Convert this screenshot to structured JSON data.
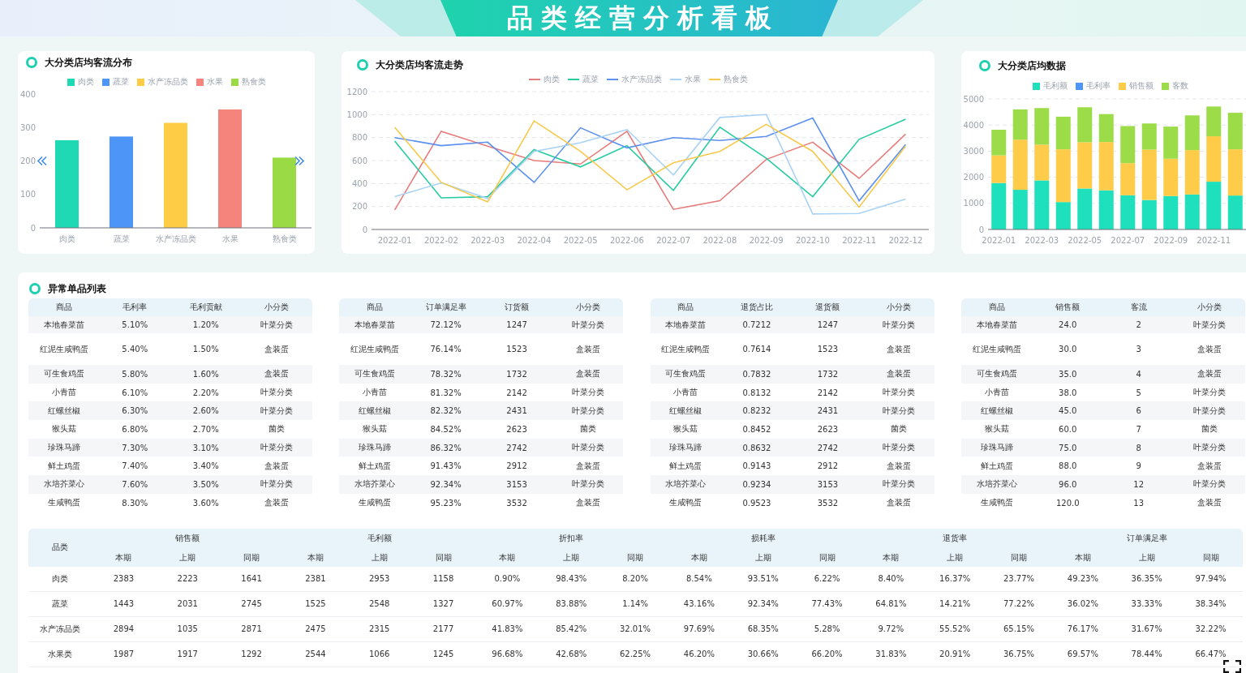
{
  "header": {
    "title": "品类经营分析看板"
  },
  "traffic_distribution": {
    "title": "大分类店均客流分布",
    "chart_data": {
      "type": "bar",
      "categories": [
        "肉类",
        "蔬菜",
        "水产冻品类",
        "水果",
        "熟食类"
      ],
      "ylim": [
        0,
        400
      ],
      "yticks": [
        0,
        100,
        200,
        300,
        400
      ],
      "series": [
        {
          "name": "肉类",
          "color": "#1fd8b4",
          "values": [
            262,
            null,
            null,
            null,
            null
          ]
        },
        {
          "name": "蔬菜",
          "color": "#4d96f7",
          "values": [
            null,
            273,
            null,
            null,
            null
          ]
        },
        {
          "name": "水产冻品类",
          "color": "#ffcd45",
          "values": [
            null,
            null,
            314,
            null,
            null
          ]
        },
        {
          "name": "水果",
          "color": "#f5857c",
          "values": [
            null,
            null,
            null,
            354,
            null
          ]
        },
        {
          "name": "熟食类",
          "color": "#9ada45",
          "values": [
            null,
            null,
            null,
            null,
            210
          ]
        }
      ]
    }
  },
  "traffic_trend": {
    "title": "大分类店均客流走势",
    "chart_data": {
      "type": "line",
      "grid": true,
      "categories": [
        "2022-01",
        "2022-02",
        "2022-03",
        "2022-04",
        "2022-05",
        "2022-06",
        "2022-07",
        "2022-08",
        "2022-09",
        "2022-10",
        "2022-11",
        "2022-12"
      ],
      "ylim": [
        0,
        1200
      ],
      "yticks": [
        0,
        200,
        400,
        600,
        800,
        1000,
        1200
      ],
      "series": [
        {
          "name": "肉类",
          "color": "#e77c7c",
          "values": [
            170,
            855,
            725,
            600,
            570,
            855,
            175,
            250,
            610,
            760,
            445,
            830
          ]
        },
        {
          "name": "蔬菜",
          "color": "#27cca0",
          "values": [
            770,
            275,
            285,
            695,
            545,
            730,
            340,
            890,
            620,
            285,
            785,
            960
          ]
        },
        {
          "name": "水产冻品类",
          "color": "#5b8ff0",
          "values": [
            800,
            730,
            760,
            410,
            885,
            710,
            800,
            775,
            810,
            970,
            250,
            740
          ]
        },
        {
          "name": "水果",
          "color": "#a9d2f5",
          "values": [
            285,
            405,
            270,
            680,
            755,
            870,
            475,
            975,
            1000,
            135,
            140,
            265
          ]
        },
        {
          "name": "熟食类",
          "color": "#f7c94a",
          "values": [
            890,
            410,
            240,
            945,
            680,
            345,
            580,
            680,
            915,
            680,
            195,
            725
          ]
        }
      ]
    }
  },
  "store_data": {
    "title": "大分类店均数据",
    "chart_data": {
      "type": "bar",
      "stacked": true,
      "grid": true,
      "categories": [
        "2022-01",
        null,
        "2022-03",
        null,
        "2022-05",
        null,
        "2022-07",
        null,
        "2022-09",
        null,
        "2022-11",
        null
      ],
      "ylim": [
        0,
        5000
      ],
      "yticks": [
        0,
        1000,
        2000,
        3000,
        4000,
        5000
      ],
      "series": [
        {
          "name": "毛利额",
          "color": "#1ee0bc",
          "values": [
            1780,
            1520,
            1880,
            1050,
            1570,
            1500,
            1310,
            1130,
            1280,
            1340,
            1830,
            1300
          ]
        },
        {
          "name": "毛利率",
          "color": "#4d96f7",
          "values": [
            null,
            null,
            null,
            null,
            null,
            null,
            null,
            null,
            null,
            null,
            null,
            null
          ]
        },
        {
          "name": "销售额",
          "color": "#ffcc4a",
          "values": [
            1060,
            1920,
            1370,
            2020,
            1770,
            1850,
            1230,
            1930,
            1430,
            1700,
            1740,
            1770
          ]
        },
        {
          "name": "客数",
          "color": "#9bdc48",
          "values": [
            980,
            1160,
            1400,
            1250,
            1340,
            1070,
            1420,
            1000,
            1230,
            1330,
            1140,
            1400
          ]
        }
      ]
    }
  },
  "anomaly_list": {
    "title": "异常单品列表",
    "tables": [
      {
        "columns": [
          "商品",
          "毛利率",
          "毛利贡献",
          "小分类"
        ],
        "rows": [
          [
            "本地春菜苗",
            "5.10%",
            "1.20%",
            "叶菜分类"
          ],
          [
            "红泥生咸鸭蛋",
            "5.40%",
            "1.50%",
            "盒装蛋"
          ],
          [
            "可生食鸡蛋",
            "5.80%",
            "1.60%",
            "盒装蛋"
          ],
          [
            "小青苗",
            "6.10%",
            "2.20%",
            "叶菜分类"
          ],
          [
            "红螺丝椒",
            "6.30%",
            "2.60%",
            "叶菜分类"
          ],
          [
            "猴头菇",
            "6.80%",
            "2.70%",
            "菌类"
          ],
          [
            "珍珠马蹄",
            "7.30%",
            "3.10%",
            "叶菜分类"
          ],
          [
            "鲜土鸡蛋",
            "7.40%",
            "3.40%",
            "盒装蛋"
          ],
          [
            "水培芥菜心",
            "7.60%",
            "3.50%",
            "叶菜分类"
          ],
          [
            "生咸鸭蛋",
            "8.30%",
            "3.60%",
            "盒装蛋"
          ]
        ]
      },
      {
        "columns": [
          "商品",
          "订单满足率",
          "订货额",
          "小分类"
        ],
        "rows": [
          [
            "本地春菜苗",
            "72.12%",
            "1247",
            "叶菜分类"
          ],
          [
            "红泥生咸鸭蛋",
            "76.14%",
            "1523",
            "盒装蛋"
          ],
          [
            "可生食鸡蛋",
            "78.32%",
            "1732",
            "盒装蛋"
          ],
          [
            "小青苗",
            "81.32%",
            "2142",
            "叶菜分类"
          ],
          [
            "红螺丝椒",
            "82.32%",
            "2431",
            "叶菜分类"
          ],
          [
            "猴头菇",
            "84.52%",
            "2623",
            "菌类"
          ],
          [
            "珍珠马蹄",
            "86.32%",
            "2742",
            "叶菜分类"
          ],
          [
            "鲜土鸡蛋",
            "91.43%",
            "2912",
            "盒装蛋"
          ],
          [
            "水培芥菜心",
            "92.34%",
            "3153",
            "叶菜分类"
          ],
          [
            "生咸鸭蛋",
            "95.23%",
            "3532",
            "盒装蛋"
          ]
        ]
      },
      {
        "columns": [
          "商品",
          "退货占比",
          "退货额",
          "小分类"
        ],
        "rows": [
          [
            "本地春菜苗",
            "0.7212",
            "1247",
            "叶菜分类"
          ],
          [
            "红泥生咸鸭蛋",
            "0.7614",
            "1523",
            "盒装蛋"
          ],
          [
            "可生食鸡蛋",
            "0.7832",
            "1732",
            "盒装蛋"
          ],
          [
            "小青苗",
            "0.8132",
            "2142",
            "叶菜分类"
          ],
          [
            "红螺丝椒",
            "0.8232",
            "2431",
            "叶菜分类"
          ],
          [
            "猴头菇",
            "0.8452",
            "2623",
            "菌类"
          ],
          [
            "珍珠马蹄",
            "0.8632",
            "2742",
            "叶菜分类"
          ],
          [
            "鲜土鸡蛋",
            "0.9143",
            "2912",
            "盒装蛋"
          ],
          [
            "水培芥菜心",
            "0.9234",
            "3153",
            "叶菜分类"
          ],
          [
            "生咸鸭蛋",
            "0.9523",
            "3532",
            "盒装蛋"
          ]
        ]
      },
      {
        "columns": [
          "商品",
          "销售额",
          "客流",
          "小分类"
        ],
        "rows": [
          [
            "本地春菜苗",
            "24.0",
            "2",
            "叶菜分类"
          ],
          [
            "红泥生咸鸭蛋",
            "30.0",
            "3",
            "盒装蛋"
          ],
          [
            "可生食鸡蛋",
            "35.0",
            "4",
            "盒装蛋"
          ],
          [
            "小青苗",
            "38.0",
            "5",
            "叶菜分类"
          ],
          [
            "红螺丝椒",
            "45.0",
            "6",
            "叶菜分类"
          ],
          [
            "猴头菇",
            "60.0",
            "7",
            "菌类"
          ],
          [
            "珍珠马蹄",
            "75.0",
            "8",
            "叶菜分类"
          ],
          [
            "鲜土鸡蛋",
            "88.0",
            "9",
            "盒装蛋"
          ],
          [
            "水培芥菜心",
            "96.0",
            "12",
            "叶菜分类"
          ],
          [
            "生咸鸭蛋",
            "120.0",
            "13",
            "盒装蛋"
          ]
        ]
      }
    ]
  },
  "category_summary": {
    "corner": "品类",
    "groups": [
      {
        "label": "销售额",
        "subcolumns": [
          "本期",
          "上期",
          "同期"
        ]
      },
      {
        "label": "毛利额",
        "subcolumns": [
          "本期",
          "上期",
          "同期"
        ]
      },
      {
        "label": "折扣率",
        "subcolumns": [
          "本期",
          "上期",
          "同期"
        ]
      },
      {
        "label": "损耗率",
        "subcolumns": [
          "本期",
          "上期",
          "同期"
        ]
      },
      {
        "label": "退货率",
        "subcolumns": [
          "本期",
          "上期",
          "同期"
        ]
      },
      {
        "label": "订单满足率",
        "subcolumns": [
          "本期",
          "上期",
          "同期"
        ]
      }
    ],
    "rows": [
      {
        "category": "肉类",
        "cells": [
          "2383",
          "2223",
          "1641",
          "2381",
          "2953",
          "1158",
          "0.90%",
          "98.43%",
          "8.20%",
          "8.54%",
          "93.51%",
          "6.22%",
          "8.40%",
          "16.37%",
          "23.77%",
          "49.23%",
          "36.35%",
          "97.94%"
        ]
      },
      {
        "category": "蔬菜",
        "cells": [
          "1443",
          "2031",
          "2745",
          "1525",
          "2548",
          "1327",
          "60.97%",
          "83.88%",
          "1.14%",
          "43.16%",
          "92.34%",
          "77.43%",
          "64.81%",
          "14.21%",
          "77.22%",
          "36.02%",
          "33.33%",
          "38.34%"
        ]
      },
      {
        "category": "水产冻品类",
        "cells": [
          "2894",
          "1035",
          "2871",
          "2475",
          "2315",
          "2177",
          "41.83%",
          "85.42%",
          "32.01%",
          "97.69%",
          "68.35%",
          "5.28%",
          "9.72%",
          "55.52%",
          "65.15%",
          "76.17%",
          "31.67%",
          "32.22%"
        ]
      },
      {
        "category": "水果类",
        "cells": [
          "1987",
          "1917",
          "1292",
          "2544",
          "1066",
          "1245",
          "96.68%",
          "42.68%",
          "62.25%",
          "46.20%",
          "30.66%",
          "66.20%",
          "31.83%",
          "20.91%",
          "36.75%",
          "69.57%",
          "78.44%",
          "66.47%"
        ]
      }
    ]
  }
}
